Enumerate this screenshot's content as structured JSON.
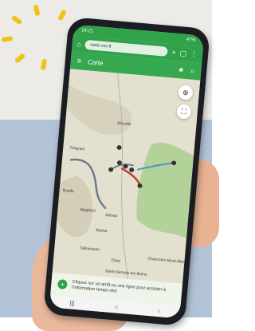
{
  "status": {
    "time": "14:21",
    "battery": "47%"
  },
  "browser": {
    "url": "carte.xxx.fr"
  },
  "appbar": {
    "title": "Carte"
  },
  "map": {
    "places": [
      {
        "name": "Morcille"
      },
      {
        "name": "Torignan"
      },
      {
        "name": "Ruelle"
      },
      {
        "name": "Magland"
      },
      {
        "name": "Salvan"
      },
      {
        "name": "Balme"
      },
      {
        "name": "Tallouisses"
      },
      {
        "name": "Thiez"
      },
      {
        "name": "Saint-Gervais-les-Bains"
      },
      {
        "name": "Chamonix-Mont-Blanc"
      }
    ]
  },
  "banner": {
    "text": "Cliquez sur un arrêt ou une ligne pour accéder à l'information temps réel"
  },
  "colors": {
    "brand": "#2fa24a",
    "route_gray": "#6d7b8c",
    "route_red": "#c0392b",
    "route_blue": "#4b8fd1"
  }
}
